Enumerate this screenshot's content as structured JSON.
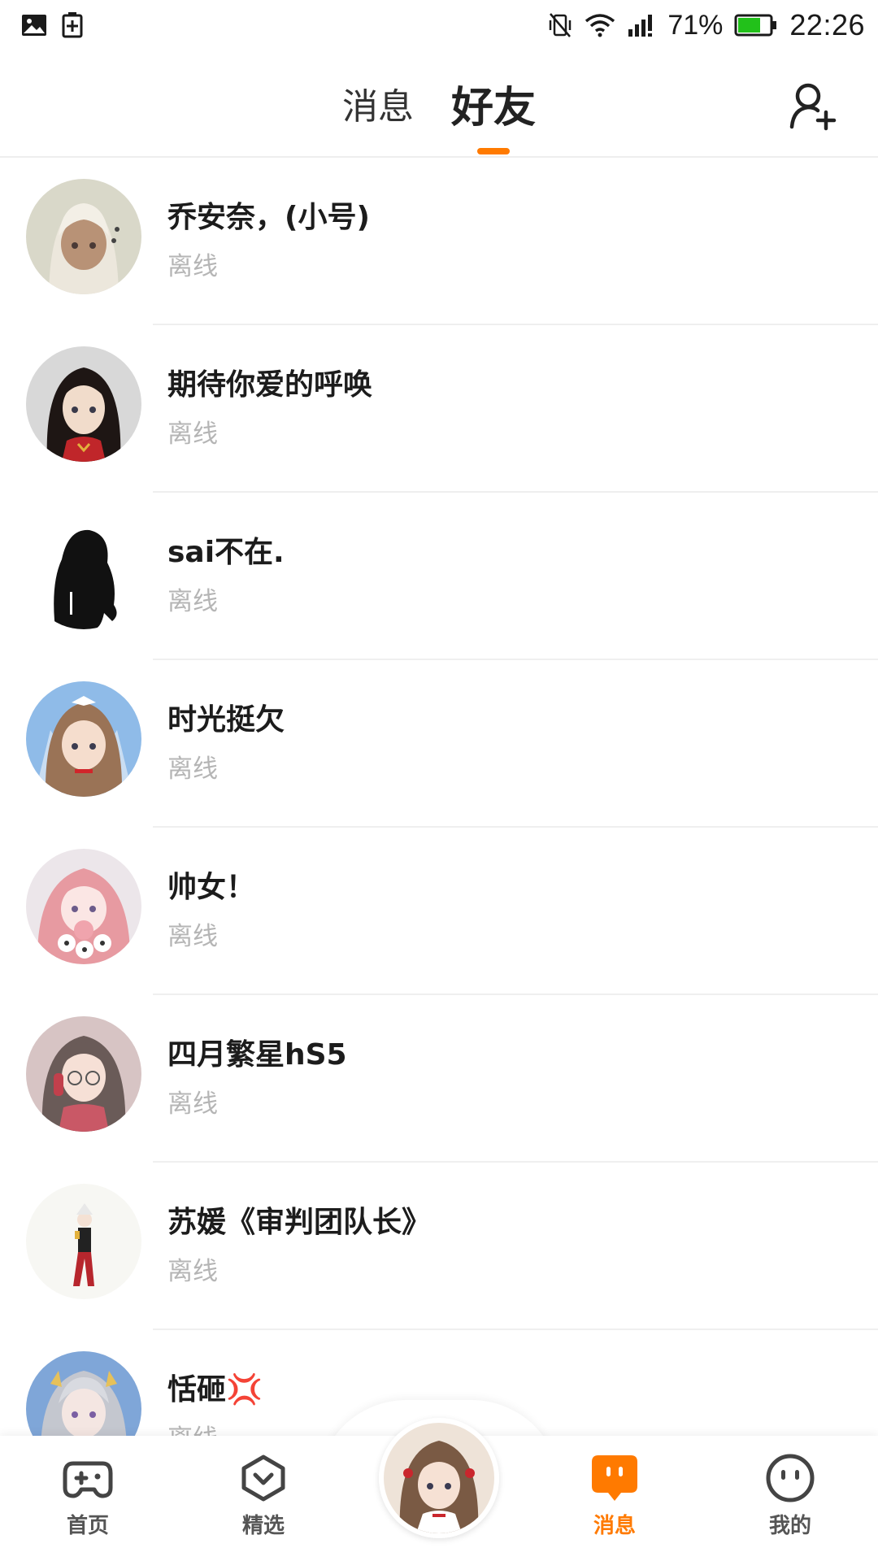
{
  "status_bar": {
    "left_icons": [
      "image-icon",
      "battery-saver-icon"
    ],
    "right_icons": [
      "vibrate-off-icon",
      "wifi-icon",
      "signal-icon"
    ],
    "battery_percent": "71%",
    "battery_level": 0.71,
    "time": "22:26",
    "battery_color": "#22c11a"
  },
  "header": {
    "tabs": [
      {
        "label": "消息",
        "active": false
      },
      {
        "label": "好友",
        "active": true
      }
    ],
    "add_friend_icon": "add-friend-icon",
    "accent_color": "#ff7a00"
  },
  "friends": [
    {
      "name": "乔安奈，(小号)",
      "status": "离线"
    },
    {
      "name": "期待你爱的呼唤",
      "status": "离线"
    },
    {
      "name": "sai不在.",
      "status": "离线"
    },
    {
      "name": "时光挺欠",
      "status": "离线"
    },
    {
      "name": "帅女！",
      "status": "离线"
    },
    {
      "name": "四月繁星hS5",
      "status": "离线"
    },
    {
      "name": "苏媛《审判团队长》",
      "status": "离线"
    },
    {
      "name": "恬砸💢",
      "status": "离线"
    }
  ],
  "bottom_nav": {
    "items": [
      {
        "label": "首页",
        "icon": "gamepad-icon",
        "active": false
      },
      {
        "label": "精选",
        "icon": "heart-badge-icon",
        "active": false
      },
      {
        "label": "消息",
        "icon": "chat-bubble-icon",
        "active": true
      },
      {
        "label": "我的",
        "icon": "face-icon",
        "active": false
      }
    ],
    "center_icon": "center-avatar"
  }
}
